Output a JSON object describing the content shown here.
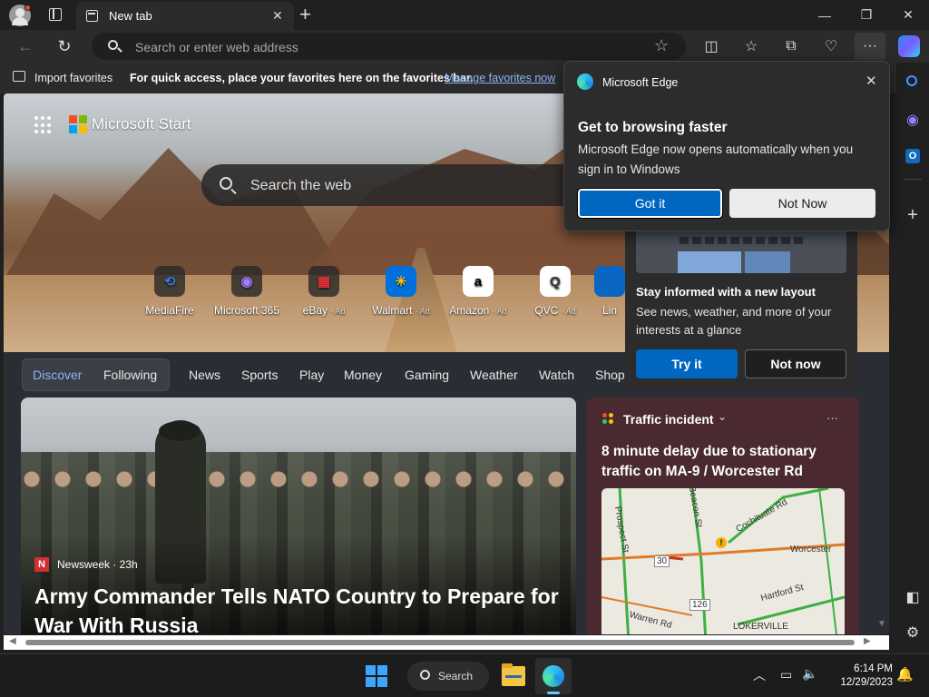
{
  "window": {
    "tab_title": "New tab",
    "new_tab_symbol": "+",
    "minimize_symbol": "—",
    "maximize_symbol": "❐",
    "close_symbol": "✕"
  },
  "toolbar": {
    "address_placeholder": "Search or enter web address"
  },
  "favorites_bar": {
    "import_label": "Import favorites",
    "hint_text": "For quick access, place your favorites here on the favorites bar.",
    "manage_link": "Manage favorites now"
  },
  "start_page": {
    "brand": "Microsoft Start",
    "search_placeholder": "Search the web",
    "sites": [
      {
        "label": "MediaFire",
        "icon": "mediafire-icon",
        "glyph": "⟲",
        "ad": ""
      },
      {
        "label": "Microsoft 365",
        "icon": "microsoft-365-icon",
        "glyph": "◉",
        "ad": ""
      },
      {
        "label": "eBay",
        "icon": "ebay-icon",
        "glyph": "▦",
        "ad": "· Ad"
      },
      {
        "label": "Walmart",
        "icon": "walmart-icon",
        "glyph": "✳",
        "ad": "· Ad"
      },
      {
        "label": "Amazon",
        "icon": "amazon-icon",
        "glyph": "a",
        "ad": "· Ad"
      },
      {
        "label": "QVC",
        "icon": "qvc-icon",
        "glyph": "Q",
        "ad": "· Ad"
      },
      {
        "label": "Lin",
        "icon": "linkedin-icon",
        "glyph": "",
        "ad": ""
      }
    ],
    "nav": [
      "Discover",
      "Following",
      "News",
      "Sports",
      "Play",
      "Money",
      "Gaming",
      "Weather",
      "Watch",
      "Shop"
    ],
    "news_card": {
      "source": "Newsweek · 23h",
      "source_badge": "N",
      "headline": "Army Commander Tells NATO Country to Prepare for War With Russia"
    },
    "traffic_card": {
      "title": "Traffic incident",
      "headline": "8 minute delay due to stationary traffic on MA-9 / Worcester Rd",
      "more": "···",
      "map_labels": [
        "Beacon St",
        "Cochituate Rd",
        "Worcester",
        "Prospect St",
        "Hartford St",
        "Warren Rd",
        "LOKERVILLE",
        "30",
        "126"
      ]
    }
  },
  "popup": {
    "brand": "Microsoft Edge",
    "heading": "Get to browsing faster",
    "body": "Microsoft Edge now opens automatically when you sign in to Windows",
    "primary_button": "Got it",
    "secondary_button": "Not Now"
  },
  "promo": {
    "heading": "Stay informed with a new layout",
    "body": "See news, weather, and more of your interests at a glance",
    "primary_button": "Try it",
    "secondary_button": "Not now"
  },
  "taskbar": {
    "search_label": "Search",
    "time": "6:14 PM",
    "date": "12/29/2023"
  },
  "colors": {
    "accent": "#0067c0",
    "link": "#8ab4f8",
    "traffic_card_bg": "#4a2a30"
  }
}
